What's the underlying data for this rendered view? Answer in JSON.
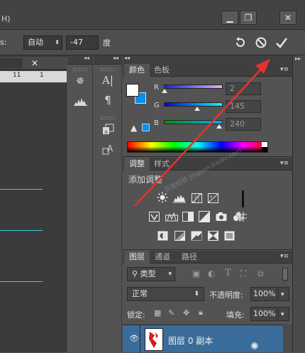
{
  "titlebar": {
    "title_fragment": "H)",
    "minimize_symbol": "▁",
    "restore_symbol": "❐",
    "close_symbol": "✕"
  },
  "options": {
    "label_fragment": "s:",
    "mode_value": "自动",
    "angle_value": "-47",
    "angle_unit": "度",
    "undo_icon": "undo-icon",
    "cancel_icon": "cancel-icon",
    "commit_icon": "checkmark-icon"
  },
  "ruler": {
    "tick_labels": [
      "11",
      "1"
    ]
  },
  "color_panel": {
    "tabs": [
      "颜色",
      "色板"
    ],
    "active_tab": "颜色",
    "channels": [
      {
        "label": "R",
        "value": "2",
        "level": 0.01,
        "gradient": "linear-gradient(90deg,#0a2ce4,#f2a8ee)"
      },
      {
        "label": "G",
        "value": "145",
        "level": 0.57,
        "gradient": "linear-gradient(90deg,#0200ea,#02fff0)"
      },
      {
        "label": "B",
        "value": "240",
        "level": 0.94,
        "gradient": "linear-gradient(90deg,#029100,#02a8ff)"
      }
    ],
    "foreground_color": "#ffffff",
    "background_color": "#0291f0"
  },
  "adjustments_panel": {
    "tabs": [
      "调整",
      "样式"
    ],
    "active_tab": "调整",
    "heading": "添加调整",
    "watermark": "百度经验 jingyan.baidu.com"
  },
  "layers_panel": {
    "tabs": [
      "图层",
      "通道",
      "路径"
    ],
    "active_tab": "图层",
    "filter_label": "类型",
    "blend_mode": "正常",
    "opacity_label": "不透明度:",
    "opacity_value": "100%",
    "lock_label": "锁定:",
    "fill_label": "填充:",
    "fill_value": "100%",
    "layers": [
      {
        "name": "图层 0 副本"
      }
    ]
  },
  "colors": {
    "accent_red": "#e23232",
    "guide_cyan": "#3fc7e6"
  }
}
